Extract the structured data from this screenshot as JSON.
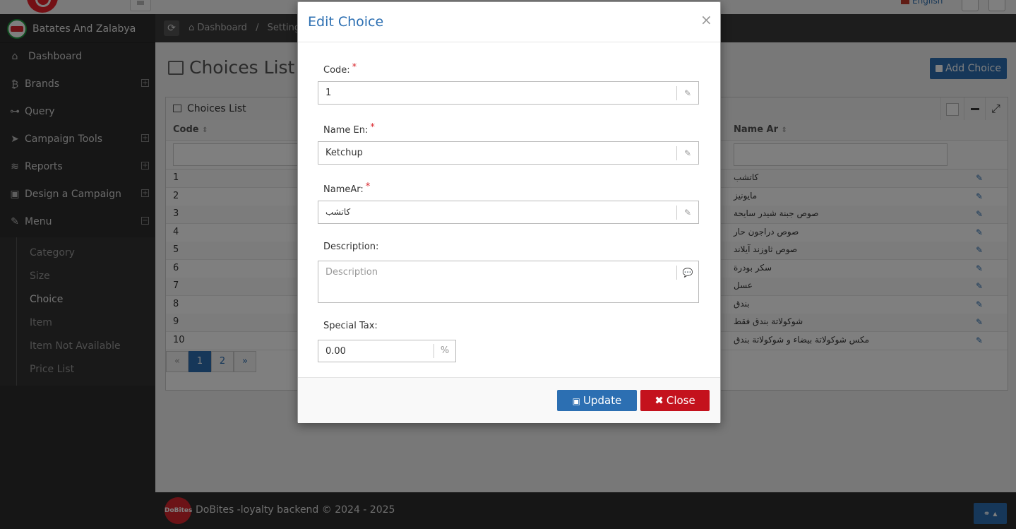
{
  "topbar": {
    "lang_label": "English"
  },
  "breadcrumb": {
    "home": "Dashboard",
    "settings": "Settings"
  },
  "sidebar": {
    "company": "Batates And Zalabya",
    "items": [
      {
        "label": "Dashboard",
        "icon": "dashboard-icon",
        "expand": ""
      },
      {
        "label": "Brands",
        "icon": "bitcoin-icon",
        "expand": "+"
      },
      {
        "label": "Query",
        "icon": "sitemap-icon",
        "expand": ""
      },
      {
        "label": "Campaign Tools",
        "icon": "send-icon",
        "expand": "+"
      },
      {
        "label": "Reports",
        "icon": "database-icon",
        "expand": "+"
      },
      {
        "label": "Design a Campaign",
        "icon": "briefcase-icon",
        "expand": "+"
      },
      {
        "label": "Menu",
        "icon": "edit-icon",
        "expand": "−"
      }
    ],
    "submenu": [
      "Category",
      "Size",
      "Choice",
      "Item",
      "Item Not Available",
      "Price List"
    ],
    "active_submenu": "Choice"
  },
  "main": {
    "title": "Choices List",
    "add_button": "Add Choice",
    "widget_title": "Choices List",
    "columns": {
      "code": "Code",
      "name_ar": "Name Ar"
    },
    "rows": [
      {
        "code": "1",
        "name_ar": "كاتشب"
      },
      {
        "code": "2",
        "name_ar": "مايونيز"
      },
      {
        "code": "3",
        "name_ar": "صوص جبنة شيدر سايحة"
      },
      {
        "code": "4",
        "name_ar": "صوص دراجون حار"
      },
      {
        "code": "5",
        "name_ar": "صوص ثاوزند آيلاند"
      },
      {
        "code": "6",
        "name_ar": "سكر بودرة"
      },
      {
        "code": "7",
        "name_ar": "عسل"
      },
      {
        "code": "8",
        "name_ar": "بندق"
      },
      {
        "code": "9",
        "name_ar": "شوكولاتة بندق فقط"
      },
      {
        "code": "10",
        "name_ar": "مكس شوكولاتة بيضاء و شوكولاتة بندق"
      }
    ],
    "pagination": {
      "prev": "«",
      "pages": [
        "1",
        "2"
      ],
      "next": "»",
      "current": "1"
    }
  },
  "footer": {
    "text": "DoBites -loyalty backend © 2024 - 2025",
    "logo_text": "DoBites"
  },
  "modal": {
    "title": "Edit Choice",
    "close_x": "×",
    "fields": {
      "code_label": "Code:",
      "code_value": "1",
      "name_en_label": "Name En:",
      "name_en_value": "Ketchup",
      "name_ar_label": "NameAr:",
      "name_ar_value": "كاتشب",
      "description_label": "Description:",
      "description_placeholder": "Description",
      "special_tax_label": "Special Tax:",
      "special_tax_value": "0.00",
      "special_tax_unit": "%"
    },
    "required_marker": "*",
    "update_button": "Update",
    "close_button": "Close"
  },
  "colors": {
    "primary": "#2c6fb2",
    "danger": "#c4121d",
    "sidebar_bg": "#2d2d2d"
  }
}
